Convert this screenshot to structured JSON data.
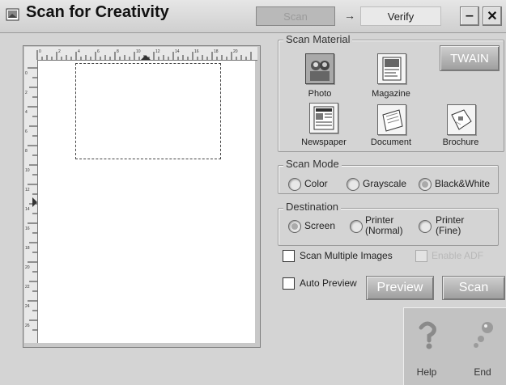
{
  "window": {
    "title": "Scan for Creativity",
    "steps": {
      "scan": "Scan",
      "arrow": "→",
      "verify": "Verify"
    },
    "minimize_glyph": "‒",
    "close_glyph": "✕"
  },
  "scan_material": {
    "label": "Scan Material",
    "items": [
      {
        "label": "Photo",
        "icon": "photo-icon",
        "selected": true
      },
      {
        "label": "Magazine",
        "icon": "magazine-icon",
        "selected": false
      },
      {
        "label": "Newspaper",
        "icon": "newspaper-icon",
        "selected": false
      },
      {
        "label": "Document",
        "icon": "document-icon",
        "selected": false
      },
      {
        "label": "Brochure",
        "icon": "brochure-icon",
        "selected": false
      }
    ]
  },
  "scan_mode": {
    "label": "Scan Mode",
    "options": [
      "Color",
      "Grayscale",
      "Black&White"
    ],
    "selected": "Black&White"
  },
  "destination": {
    "label": "Destination",
    "options": [
      {
        "line1": "Screen",
        "line2": ""
      },
      {
        "line1": "Printer",
        "line2": "(Normal)"
      },
      {
        "line1": "Printer",
        "line2": "(Fine)"
      }
    ],
    "selected": "Screen"
  },
  "options": {
    "scan_multiple": "Scan Multiple Images",
    "enable_adf": "Enable ADF",
    "auto_preview": "Auto Preview"
  },
  "buttons": {
    "twain": "TWAIN",
    "preview": "Preview",
    "scan": "Scan",
    "help": "Help",
    "end": "End"
  },
  "ruler": {
    "top_labels": [
      "0",
      "2",
      "4",
      "6",
      "8",
      "10",
      "12",
      "14",
      "16",
      "18",
      "20"
    ],
    "left_labels": [
      "0",
      "2",
      "4",
      "6",
      "8",
      "10",
      "12",
      "14",
      "16",
      "18",
      "20",
      "22",
      "24",
      "26"
    ]
  }
}
